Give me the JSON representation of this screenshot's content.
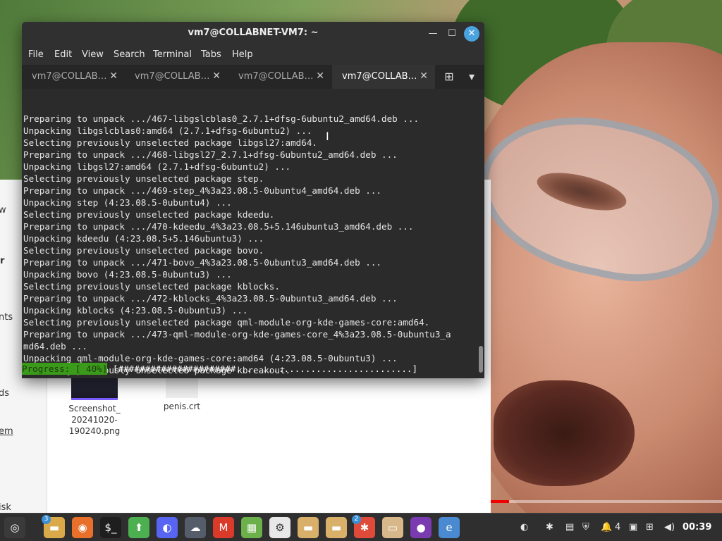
{
  "terminal": {
    "title": "vm7@COLLABNET-VM7: ~",
    "menu": [
      "File",
      "Edit",
      "View",
      "Search",
      "Terminal",
      "Tabs",
      "Help"
    ],
    "tabs": [
      {
        "label": "vm7@COLLAB…",
        "close": "✕"
      },
      {
        "label": "vm7@COLLAB…",
        "close": "✕"
      },
      {
        "label": "vm7@COLLAB…",
        "close": "✕"
      },
      {
        "label": "vm7@COLLAB…",
        "close": "✕"
      }
    ],
    "active_tab": 3,
    "lines": [
      "Preparing to unpack .../467-libgslcblas0_2.7.1+dfsg-6ubuntu2_amd64.deb ...",
      "Unpacking libgslcblas0:amd64 (2.7.1+dfsg-6ubuntu2) ...",
      "Selecting previously unselected package libgsl27:amd64.",
      "Preparing to unpack .../468-libgsl27_2.7.1+dfsg-6ubuntu2_amd64.deb ...",
      "Unpacking libgsl27:amd64 (2.7.1+dfsg-6ubuntu2) ...",
      "Selecting previously unselected package step.",
      "Preparing to unpack .../469-step_4%3a23.08.5-0ubuntu4_amd64.deb ...",
      "Unpacking step (4:23.08.5-0ubuntu4) ...",
      "Selecting previously unselected package kdeedu.",
      "Preparing to unpack .../470-kdeedu_4%3a23.08.5+5.146ubuntu3_amd64.deb ...",
      "Unpacking kdeedu (4:23.08.5+5.146ubuntu3) ...",
      "Selecting previously unselected package bovo.",
      "Preparing to unpack .../471-bovo_4%3a23.08.5-0ubuntu3_amd64.deb ...",
      "Unpacking bovo (4:23.08.5-0ubuntu3) ...",
      "Selecting previously unselected package kblocks.",
      "Preparing to unpack .../472-kblocks_4%3a23.08.5-0ubuntu3_amd64.deb ...",
      "Unpacking kblocks (4:23.08.5-0ubuntu3) ...",
      "Selecting previously unselected package qml-module-org-kde-games-core:amd64.",
      "Preparing to unpack .../473-qml-module-org-kde-games-core_4%3a23.08.5-0ubuntu3_a",
      "md64.deb ...",
      "Unpacking qml-module-org-kde-games-core:amd64 (4:23.08.5-0ubuntu3) ...",
      "Selecting previously unselected package kbreakout."
    ],
    "progress_label": "Progress: [ 40%]",
    "progress_bar": " [######################.................................]",
    "progress_value": 0.4
  },
  "file_manager": {
    "sidebar_fragments": [
      "w",
      "r",
      "nts",
      "ds",
      "em",
      "isk"
    ],
    "files": [
      {
        "name_lines": [
          "Screenshot_",
          "20241020-",
          "190240.png"
        ],
        "icon": "image-thumbnail-icon"
      },
      {
        "name_lines": [
          "penis.crt"
        ],
        "icon": "certificate-file-icon"
      }
    ]
  },
  "video": {
    "progress": 0.08
  },
  "taskbar": {
    "apps": [
      {
        "name": "menu-icon",
        "glyph": "◎",
        "bg": "#3a3a3a"
      },
      {
        "name": "files-folder-icon",
        "glyph": "▬",
        "bg": "#d9a94a",
        "badge": "3"
      },
      {
        "name": "firefox-icon",
        "glyph": "◉",
        "bg": "#e8702a"
      },
      {
        "name": "terminal-icon",
        "glyph": "$_",
        "bg": "#1e1e1e"
      },
      {
        "name": "update-manager-icon",
        "glyph": "⬆",
        "bg": "#4caf50"
      },
      {
        "name": "discord-icon",
        "glyph": "◐",
        "bg": "#5865f2"
      },
      {
        "name": "cloud-icon",
        "glyph": "☁",
        "bg": "#555d6a"
      },
      {
        "name": "mario-game-icon",
        "glyph": "M",
        "bg": "#d93a2a"
      },
      {
        "name": "calculator-icon",
        "glyph": "▦",
        "bg": "#6bb04a"
      },
      {
        "name": "settings-gear-icon",
        "glyph": "⚙",
        "bg": "#e8e8e8"
      },
      {
        "name": "folder-icon",
        "glyph": "▬",
        "bg": "#d9b06a"
      },
      {
        "name": "folder-icon-2",
        "glyph": "▬",
        "bg": "#d9b06a"
      },
      {
        "name": "bee-game-icon",
        "glyph": "✱",
        "bg": "#e04a3a",
        "badge": "2"
      },
      {
        "name": "archive-box-icon",
        "glyph": "▭",
        "bg": "#d8b88a"
      },
      {
        "name": "purple-orb-icon",
        "glyph": "●",
        "bg": "#7a3ab0"
      },
      {
        "name": "web-browser-icon",
        "glyph": "e",
        "bg": "#4a8ad0"
      }
    ],
    "tray": [
      {
        "name": "discord-tray-icon",
        "glyph": "◐"
      },
      {
        "name": "bee-tray-icon",
        "glyph": "✱"
      },
      {
        "name": "clipboard-tray-icon",
        "glyph": "▤"
      },
      {
        "name": "shield-tray-icon",
        "glyph": "⛨"
      },
      {
        "name": "notification-bell-icon",
        "glyph": "🔔"
      },
      {
        "name": "notification-count",
        "glyph": "4"
      },
      {
        "name": "document-tray-icon",
        "glyph": "▣"
      },
      {
        "name": "network-tray-icon",
        "glyph": "⊞"
      },
      {
        "name": "volume-tray-icon",
        "glyph": "◀)"
      }
    ],
    "clock": "00:39"
  },
  "colors": {
    "terminal_bg": "#2b2b2b",
    "progress_green": "#3a9a1a",
    "close_button": "#4aa3df"
  }
}
